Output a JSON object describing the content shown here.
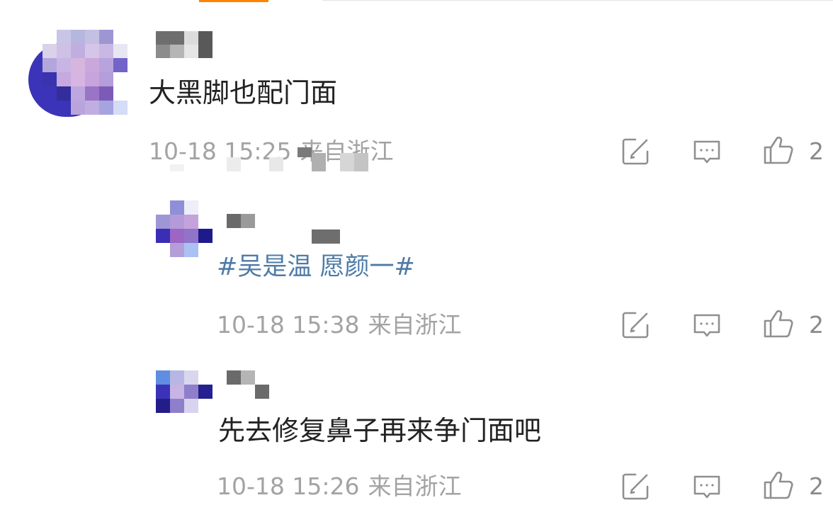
{
  "colors": {
    "accent": "#ff8200",
    "text_primary": "#222222",
    "text_meta": "#a3a3a3",
    "topic_link": "#4e7ba6",
    "icon": "#8f8f8f"
  },
  "icons": {
    "repost": "share-edit-icon",
    "comment": "comment-icon",
    "like": "thumbs-up-icon"
  },
  "comments": [
    {
      "text": "大黑脚也配门面",
      "time": "10-18 15:25",
      "source": "来自浙江",
      "likes": "2"
    },
    {
      "text": "#吴是温 愿颜一#",
      "time": "10-18 15:38",
      "source": "来自浙江",
      "likes": "2"
    },
    {
      "text": "先去修复鼻子再来争门面吧",
      "time": "10-18 15:26",
      "source": "来自浙江",
      "likes": "2"
    }
  ]
}
